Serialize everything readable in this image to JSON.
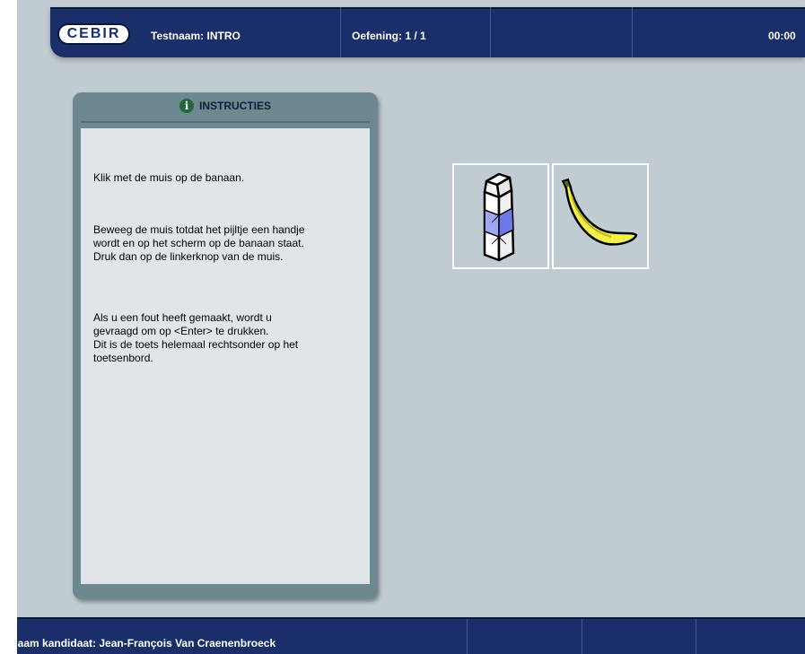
{
  "header": {
    "logo": "CEBIR",
    "test_label": "Testnaam:",
    "test_name": "INTRO",
    "exercise_label": "Oefening:",
    "exercise_value": "1 / 1",
    "timer": "00:00"
  },
  "instructions": {
    "title": "INSTRUCTIES",
    "paragraphs": [
      "Klik met de muis op de banaan.",
      "Beweeg de muis totdat het pijltje een handje\nwordt en op het scherm op de banaan staat.\nDruk dan op de linkerknop van de muis.",
      "Als u een fout heeft gemaakt, wordt u\ngevraagd om op <Enter> te drukken.\nDit is de toets helemaal rechtsonder op het\ntoetsenbord."
    ]
  },
  "choices": [
    {
      "icon": "milk-carton-icon"
    },
    {
      "icon": "banana-icon"
    }
  ],
  "footer": {
    "candidate_label": "Naam kandidaat:",
    "candidate_name": "Jean-François Van Craenenbroeck"
  },
  "colors": {
    "bar": "#1a2f6a",
    "background": "#c1ccd2",
    "panel": "#6d888e",
    "panel_body": "#dfe5e9"
  }
}
